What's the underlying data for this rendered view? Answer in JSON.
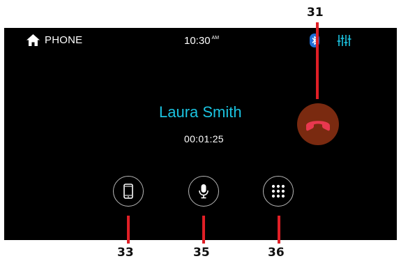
{
  "status_bar": {
    "screen_title": "PHONE",
    "home_icon": "home-icon",
    "clock_time": "10:30",
    "clock_ampm": "AM",
    "bluetooth_icon": "bluetooth-icon",
    "equalizer_icon": "equalizer-icon"
  },
  "call": {
    "caller_name": "Laura Smith",
    "duration": "00:01:25"
  },
  "buttons": {
    "end_call_icon": "end-call-icon",
    "phone_icon": "smartphone-icon",
    "mic_icon": "microphone-icon",
    "keypad_icon": "keypad-icon"
  },
  "callouts": [
    "31",
    "33",
    "35",
    "36"
  ],
  "colors": {
    "accent": "#1bc3e0",
    "end_call_bg": "#7a2a10",
    "end_call_icon": "#e8384f",
    "callout_line": "#e01f26",
    "bluetooth": "#1e6fd8"
  }
}
